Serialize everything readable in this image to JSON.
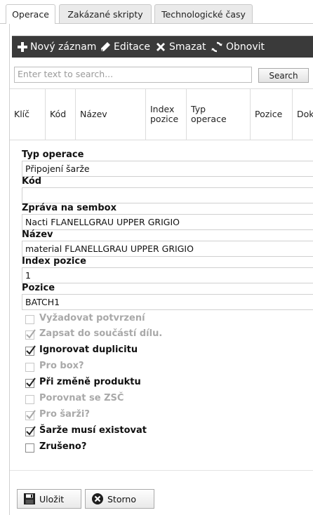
{
  "tabs": [
    {
      "label": "Operace",
      "active": true
    },
    {
      "label": "Zakázané skripty",
      "active": false
    },
    {
      "label": "Technologické časy",
      "active": false
    }
  ],
  "toolbar": {
    "new_label": "Nový záznam",
    "edit_label": "Editace",
    "delete_label": "Smazat",
    "refresh_label": "Obnovit"
  },
  "search": {
    "placeholder": "Enter text to search...",
    "button_label": "Search"
  },
  "grid": {
    "columns": [
      "Klíč",
      "Kód",
      "Název",
      "Index\npozice",
      "Typ\noperace",
      "Pozice",
      "Dok"
    ]
  },
  "form": {
    "type_label": "Typ operace",
    "type_value": "Připojení šarže",
    "code_label": "Kód",
    "code_value": "",
    "message_label": "Zpráva na sembox",
    "message_value": "Nacti FLANELLGRAU UPPER GRIGIO",
    "name_label": "Název",
    "name_value": "material FLANELLGRAU UPPER GRIGIO",
    "index_label": "Index pozice",
    "index_value": "1",
    "position_label": "Pozice",
    "position_value": "BATCH1"
  },
  "checkboxes": [
    {
      "label": "Vyžadovat potvrzení",
      "checked": false,
      "disabled": true
    },
    {
      "label": "Zapsat do součástí dílu.",
      "checked": true,
      "disabled": true
    },
    {
      "label": "Ignorovat duplicitu",
      "checked": true,
      "disabled": false
    },
    {
      "label": "Pro box?",
      "checked": false,
      "disabled": true
    },
    {
      "label": "Při změně produktu",
      "checked": true,
      "disabled": false
    },
    {
      "label": "Porovnat se ZSČ",
      "checked": false,
      "disabled": true
    },
    {
      "label": "Pro šarži?",
      "checked": true,
      "disabled": true
    },
    {
      "label": "Šarže musí existovat",
      "checked": true,
      "disabled": false
    },
    {
      "label": "Zrušeno?",
      "checked": false,
      "disabled": false
    }
  ],
  "footer": {
    "save_label": "Uložit",
    "cancel_label": "Storno"
  },
  "colors": {
    "toolbar_bg": "#3a3a3a",
    "border": "#d0d0d0",
    "disabled_text": "#a9a9a9"
  }
}
